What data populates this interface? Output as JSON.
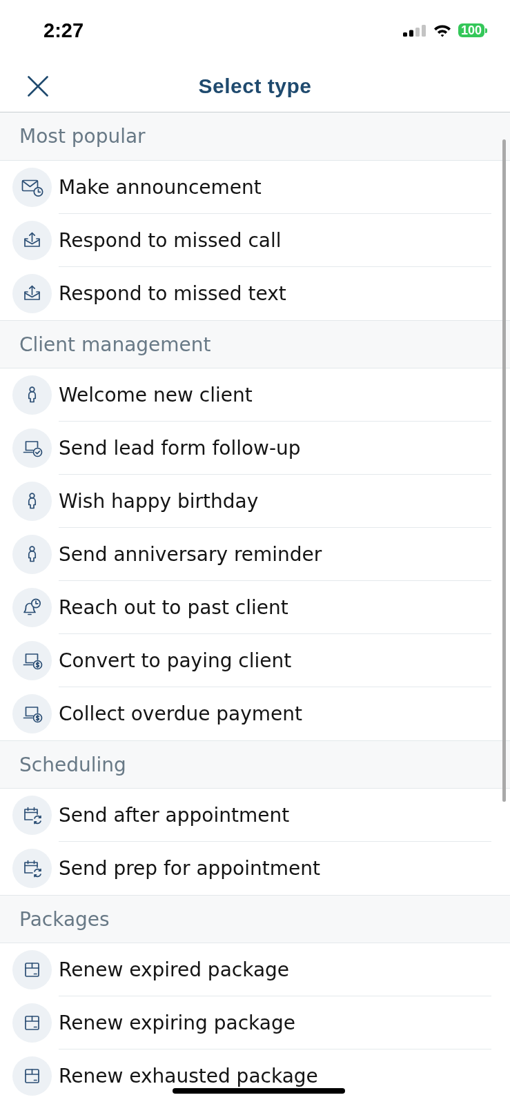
{
  "status_bar": {
    "time": "2:27",
    "battery": "100"
  },
  "header": {
    "title": "Select type"
  },
  "sections": [
    {
      "title": "Most popular",
      "items": [
        {
          "label": "Make announcement",
          "kind": "announcement"
        },
        {
          "label": "Respond to missed call",
          "kind": "response"
        },
        {
          "label": "Respond to missed text",
          "kind": "response"
        }
      ]
    },
    {
      "title": "Client management",
      "items": [
        {
          "label": "Welcome new client",
          "kind": "client"
        },
        {
          "label": "Send lead form follow-up",
          "kind": "leadform"
        },
        {
          "label": "Wish happy birthday",
          "kind": "client"
        },
        {
          "label": "Send anniversary reminder",
          "kind": "client"
        },
        {
          "label": "Reach out to past client",
          "kind": "outreach"
        },
        {
          "label": "Convert to paying client",
          "kind": "payment"
        },
        {
          "label": "Collect overdue payment",
          "kind": "payment"
        }
      ]
    },
    {
      "title": "Scheduling",
      "items": [
        {
          "label": "Send after appointment",
          "kind": "appointment"
        },
        {
          "label": "Send prep for appointment",
          "kind": "appointment"
        }
      ]
    },
    {
      "title": "Packages",
      "items": [
        {
          "label": "Renew expired package",
          "kind": "package"
        },
        {
          "label": "Renew expiring package",
          "kind": "package"
        },
        {
          "label": "Renew exhausted package",
          "kind": "package"
        }
      ]
    }
  ]
}
